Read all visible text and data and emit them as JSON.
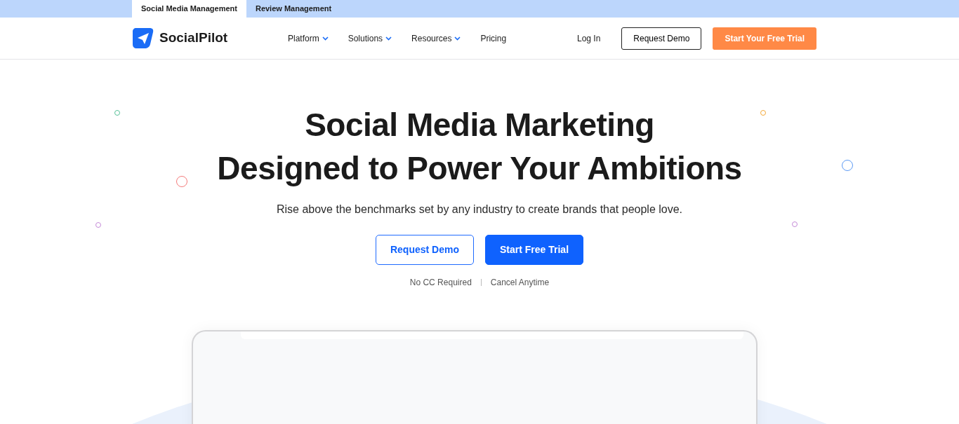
{
  "product_tabs": [
    {
      "label": "Social Media Management",
      "selected": true
    },
    {
      "label": "Review Management",
      "selected": false
    }
  ],
  "navbar": {
    "brand": "SocialPilot",
    "menu": [
      {
        "label": "Platform",
        "dropdown": true
      },
      {
        "label": "Solutions",
        "dropdown": true
      },
      {
        "label": "Resources",
        "dropdown": true
      },
      {
        "label": "Pricing",
        "dropdown": false
      }
    ],
    "login": "Log In",
    "demo_button": "Request Demo",
    "trial_button": "Start Your Free Trial"
  },
  "hero": {
    "title_lines": [
      "Social Media Marketing",
      "Designed to Power Your Ambitions"
    ],
    "subtitle": "Rise above the benchmarks set by any industry to create brands that people love.",
    "buttons": [
      {
        "label": "Request Demo",
        "kind": "outline"
      },
      {
        "label": "Start Free Trial",
        "kind": "primary"
      }
    ],
    "notes": [
      "No CC Required",
      "Cancel Anytime"
    ]
  }
}
